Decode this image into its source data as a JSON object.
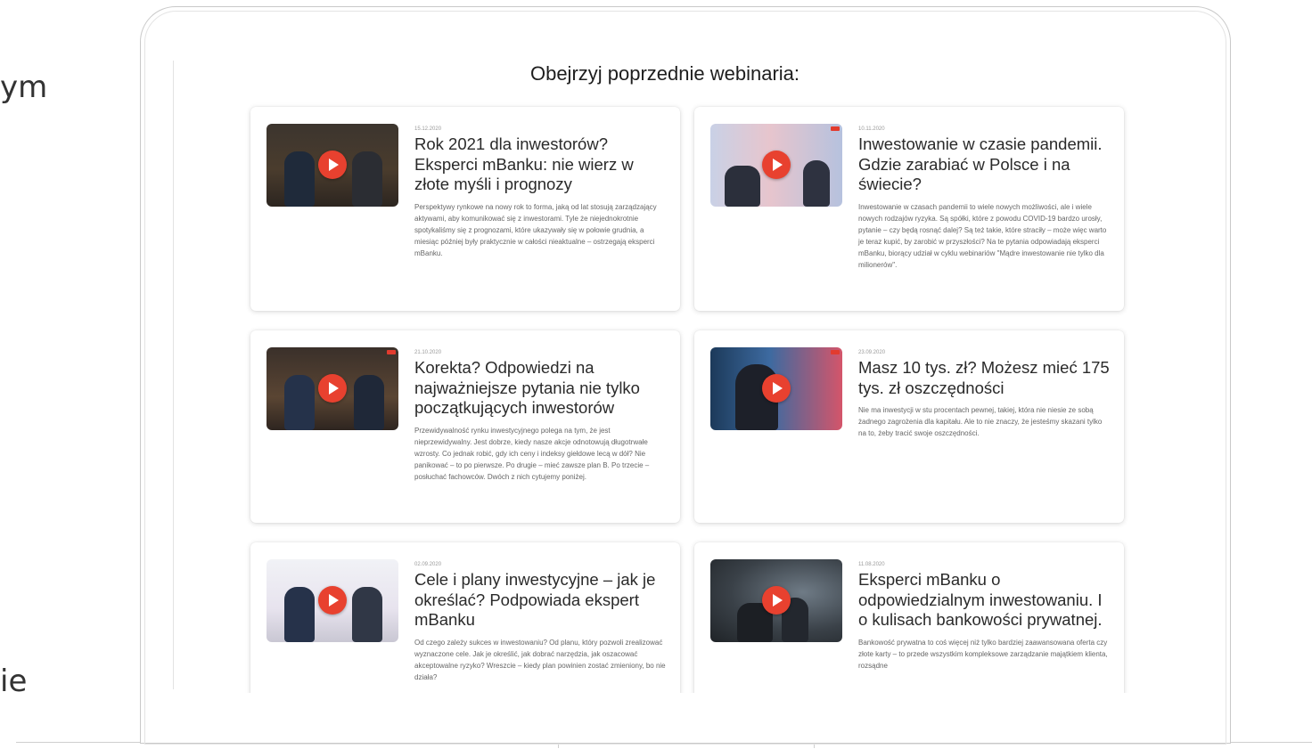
{
  "side": {
    "top_fragment": "ym",
    "bottom_fragment": "ie"
  },
  "section_heading": "Obejrzyj poprzednie webinaria:",
  "cards": [
    {
      "date": "15.12.2020",
      "title": "Rok 2021 dla inwestorów? Eksperci mBanku: nie wierz w złote myśli i prognozy",
      "description": "Perspektywy rynkowe na nowy rok to forma, jaką od lat stosują zarządzający aktywami, aby komunikować się z inwestorami. Tyle że niejednokrotnie spotykaliśmy się z prognozami, które ukazywały się w połowie grudnia, a miesiąc później były praktycznie w całości nieaktualne – ostrzegają eksperci mBanku."
    },
    {
      "date": "10.11.2020",
      "title": "Inwestowanie w czasie pandemii. Gdzie zarabiać w Polsce i na świecie?",
      "description": "Inwestowanie w czasach pandemii to wiele nowych możliwości, ale i wiele nowych rodzajów ryzyka. Są spółki, które z powodu COVID-19 bardzo urosły, pytanie – czy będą rosnąć dalej? Są też takie, które straciły – może więc warto je teraz kupić, by zarobić w przyszłości? Na te pytania odpowiadają eksperci mBanku, biorący udział w cyklu webinariów \"Mądre inwestowanie nie tylko dla milionerów\"."
    },
    {
      "date": "21.10.2020",
      "title": "Korekta? Odpowiedzi na najważniejsze pytania nie tylko początkujących inwestorów",
      "description": "Przewidywalność rynku inwestycyjnego polega na tym, że jest nieprzewidywalny. Jest dobrze, kiedy nasze akcje odnotowują długotrwałe wzrosty. Co jednak robić, gdy ich ceny i indeksy giełdowe lecą w dół? Nie panikować – to po pierwsze. Po drugie – mieć zawsze plan B. Po trzecie – posłuchać fachowców. Dwóch z nich cytujemy poniżej."
    },
    {
      "date": "23.09.2020",
      "title": "Masz 10 tys. zł? Możesz mieć 175 tys. zł oszczędności",
      "description": "Nie ma inwestycji w stu procentach pewnej, takiej, która nie niesie ze sobą żadnego zagrożenia dla kapitału. Ale to nie znaczy, że jesteśmy skazani tylko na to, żeby tracić swoje oszczędności."
    },
    {
      "date": "02.09.2020",
      "title": "Cele i plany inwestycyjne – jak je określać? Podpowiada ekspert mBanku",
      "description": "Od czego zależy sukces w inwestowaniu? Od planu, który pozwoli zrealizować wyznaczone cele. Jak je określić, jak dobrać narzędzia, jak oszacować akceptowalne ryzyko? Wreszcie – kiedy plan powinien zostać zmieniony, bo nie działa?"
    },
    {
      "date": "11.08.2020",
      "title": "Eksperci mBanku o odpowiedzialnym inwestowaniu. I o kulisach bankowości prywatnej.",
      "description": "Bankowość prywatna to coś więcej niż tylko bardziej zaawansowana oferta czy złote karty – to przede wszystkim kompleksowe zarządzanie majątkiem klienta, rozsądne"
    }
  ]
}
